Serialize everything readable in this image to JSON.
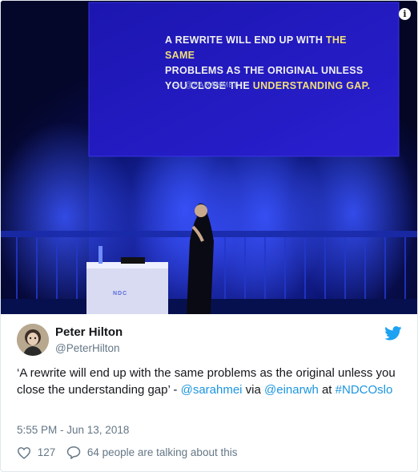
{
  "photo": {
    "slide_line1_pre": "A rewrite will end up with ",
    "slide_line1_hl": "the same",
    "slide_line2": "problems as the original unless",
    "slide_line3_pre": "you close the ",
    "slide_line3_hl": "understanding gap.",
    "slide_attribution": "— @sarahmei",
    "podium_label": "NDC",
    "info_label": "i"
  },
  "tweet": {
    "author_name": "Peter Hilton",
    "author_handle": "@PeterHilton",
    "text_part1": "‘A rewrite will end up with the same problems as the original unless you close the understanding gap’ - ",
    "mention1": "@sarahmei",
    "text_part2": " via ",
    "mention2": "@einarwh",
    "text_part3": " at ",
    "hashtag": "#NDCOslo",
    "timestamp": "5:55 PM - Jun 13, 2018",
    "like_count": "127",
    "talking_text": "64 people are talking about this"
  },
  "colors": {
    "link": "#1b95e0",
    "twitter_blue": "#1da1f2",
    "muted": "#657786",
    "slide_bg": "#1f18b8"
  },
  "icons": {
    "info": "info-icon",
    "bird": "twitter-bird-icon",
    "like": "heart-icon",
    "reply": "speech-bubble-icon"
  }
}
